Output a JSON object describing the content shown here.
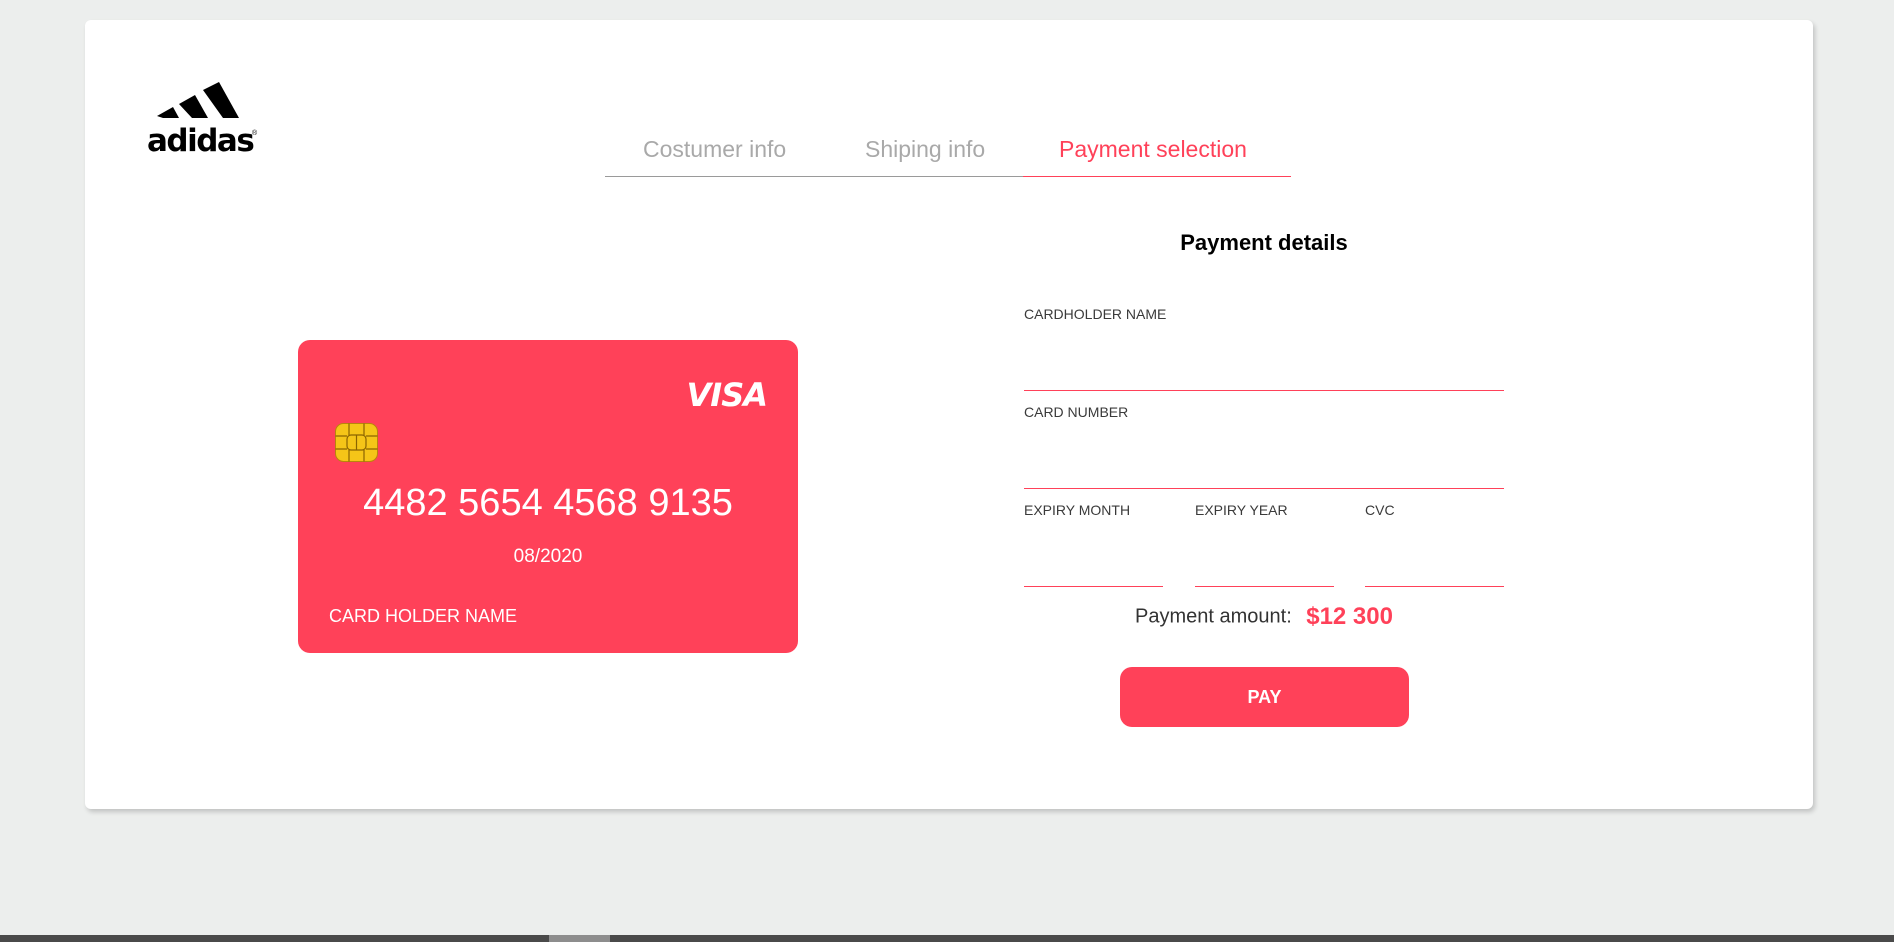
{
  "brand": {
    "name": "adidas",
    "registered_mark": "®"
  },
  "steps": {
    "items": [
      {
        "label": "Costumer info",
        "active": false
      },
      {
        "label": "Shiping info",
        "active": false
      },
      {
        "label": "Payment selection",
        "active": true
      }
    ]
  },
  "card": {
    "network": "VISA",
    "number": "4482 5654 4568 9135",
    "expiry": "08/2020",
    "holder": "CARD HOLDER NAME",
    "color": "#ff4159"
  },
  "form": {
    "title": "Payment details",
    "cardholder_name": {
      "label": "CARDHOLDER NAME",
      "value": ""
    },
    "card_number": {
      "label": "CARD NUMBER",
      "value": ""
    },
    "expiry_month": {
      "label": "EXPIRY MONTH",
      "value": ""
    },
    "expiry_year": {
      "label": "EXPIRY YEAR",
      "value": ""
    },
    "cvc": {
      "label": "CVC",
      "value": ""
    },
    "amount_label": "Payment amount:",
    "amount_value": "$12 300",
    "pay_label": "PAY"
  },
  "colors": {
    "accent": "#ff4159",
    "background": "#eceeed",
    "panel": "#ffffff"
  }
}
